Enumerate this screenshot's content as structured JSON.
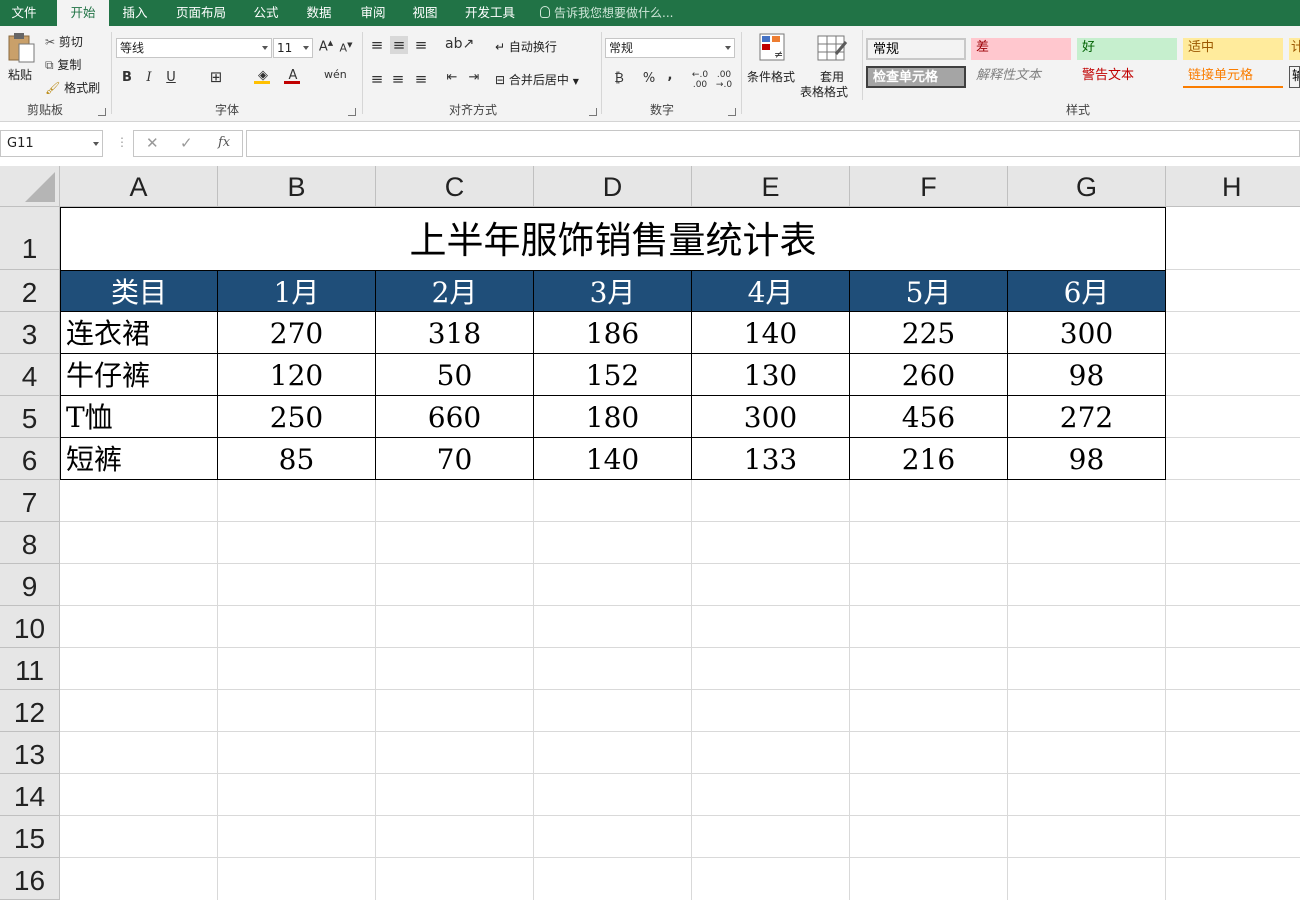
{
  "ribbon": {
    "tabs": [
      "文件",
      "开始",
      "插入",
      "页面布局",
      "公式",
      "数据",
      "审阅",
      "视图",
      "开发工具"
    ],
    "active_tab": "开始",
    "tell_me": "告诉我您想要做什么...",
    "clipboard": {
      "paste": "粘贴",
      "cut": "剪切",
      "copy": "复制",
      "format_painter": "格式刷",
      "label": "剪贴板"
    },
    "font": {
      "name": "等线",
      "size": "11",
      "label": "字体",
      "bold": "B",
      "italic": "I",
      "underline": "U"
    },
    "alignment": {
      "wrap": "自动换行",
      "merge": "合并后居中",
      "label": "对齐方式"
    },
    "number": {
      "format": "常规",
      "percent": "%",
      "comma": ",",
      "label": "数字"
    },
    "styles": {
      "conditional": "条件格式",
      "table_format_1": "套用",
      "table_format_2": "表格格式",
      "label": "样式",
      "cells": [
        {
          "text": "常规",
          "bg": "#ffffff",
          "color": "#000000"
        },
        {
          "text": "差",
          "bg": "#ffc7ce",
          "color": "#9c0006"
        },
        {
          "text": "好",
          "bg": "#c6efce",
          "color": "#006100"
        },
        {
          "text": "适中",
          "bg": "#ffeb9c",
          "color": "#9c5700"
        },
        {
          "text": "检查单元格",
          "bg": "#a5a5a5",
          "color": "#ffffff"
        },
        {
          "text": "解释性文本",
          "bg": "#ffffff",
          "color": "#7f7f7f"
        },
        {
          "text": "警告文本",
          "bg": "#ffffff",
          "color": "#c00000"
        },
        {
          "text": "链接单元格",
          "bg": "#ffffff",
          "color": "#fa7d00"
        }
      ],
      "overflow_1": "计",
      "overflow_2": "输"
    }
  },
  "formula_bar": {
    "name_box": "G11",
    "fx": "fx",
    "formula": ""
  },
  "columns": [
    "A",
    "B",
    "C",
    "D",
    "E",
    "F",
    "G",
    "H"
  ],
  "rows": [
    "1",
    "2",
    "3",
    "4",
    "5",
    "6",
    "7",
    "8",
    "9",
    "10",
    "11",
    "12",
    "13",
    "14",
    "15",
    "16"
  ],
  "sheet": {
    "title": "上半年服饰销售量统计表",
    "header": [
      "类目",
      "1月",
      "2月",
      "3月",
      "4月",
      "5月",
      "6月"
    ],
    "data": [
      [
        "连衣裙",
        "270",
        "318",
        "186",
        "140",
        "225",
        "300"
      ],
      [
        "牛仔裤",
        "120",
        "50",
        "152",
        "130",
        "260",
        "98"
      ],
      [
        "T恤",
        "250",
        "660",
        "180",
        "300",
        "456",
        "272"
      ],
      [
        "短裤",
        "85",
        "70",
        "140",
        "133",
        "216",
        "98"
      ]
    ]
  },
  "colors": {
    "accent": "#217346",
    "header_fill": "#1f4e79"
  }
}
